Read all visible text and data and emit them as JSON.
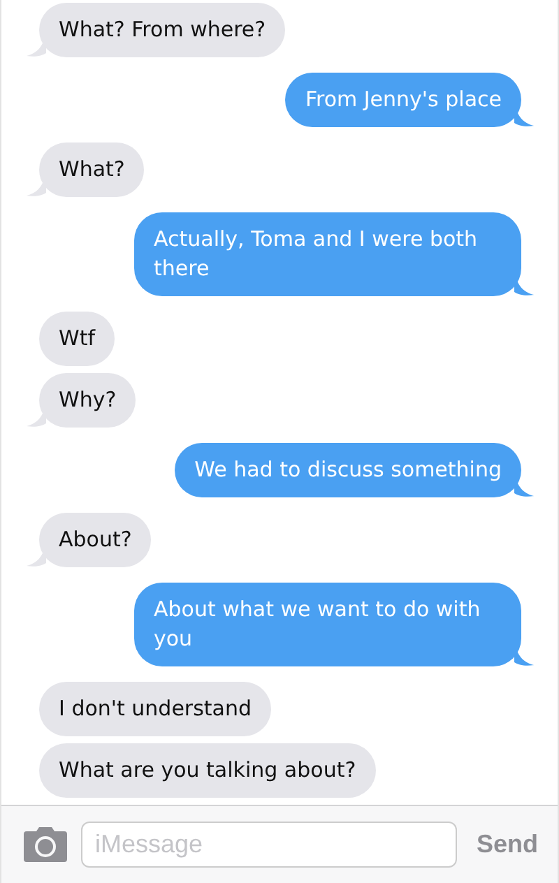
{
  "messages": [
    {
      "text": "What? From where?",
      "kind": "incoming",
      "tail": true
    },
    {
      "text": "From Jenny's place",
      "kind": "outgoing",
      "tail": true
    },
    {
      "text": "What?",
      "kind": "incoming",
      "tail": true
    },
    {
      "text": "Actually, Toma and I were both there",
      "kind": "outgoing",
      "tail": true
    },
    {
      "text": "Wtf",
      "kind": "incoming",
      "tail": false
    },
    {
      "text": "Why?",
      "kind": "incoming",
      "tail": true
    },
    {
      "text": "We had to discuss something",
      "kind": "outgoing",
      "tail": true
    },
    {
      "text": "About?",
      "kind": "incoming",
      "tail": true
    },
    {
      "text": "About what we want to do with you",
      "kind": "outgoing",
      "tail": true
    },
    {
      "text": "I don't understand",
      "kind": "incoming",
      "tail": false
    },
    {
      "text": "What are you talking about?",
      "kind": "incoming",
      "tail": false
    }
  ],
  "composer": {
    "placeholder": "iMessage",
    "send_label": "Send"
  }
}
